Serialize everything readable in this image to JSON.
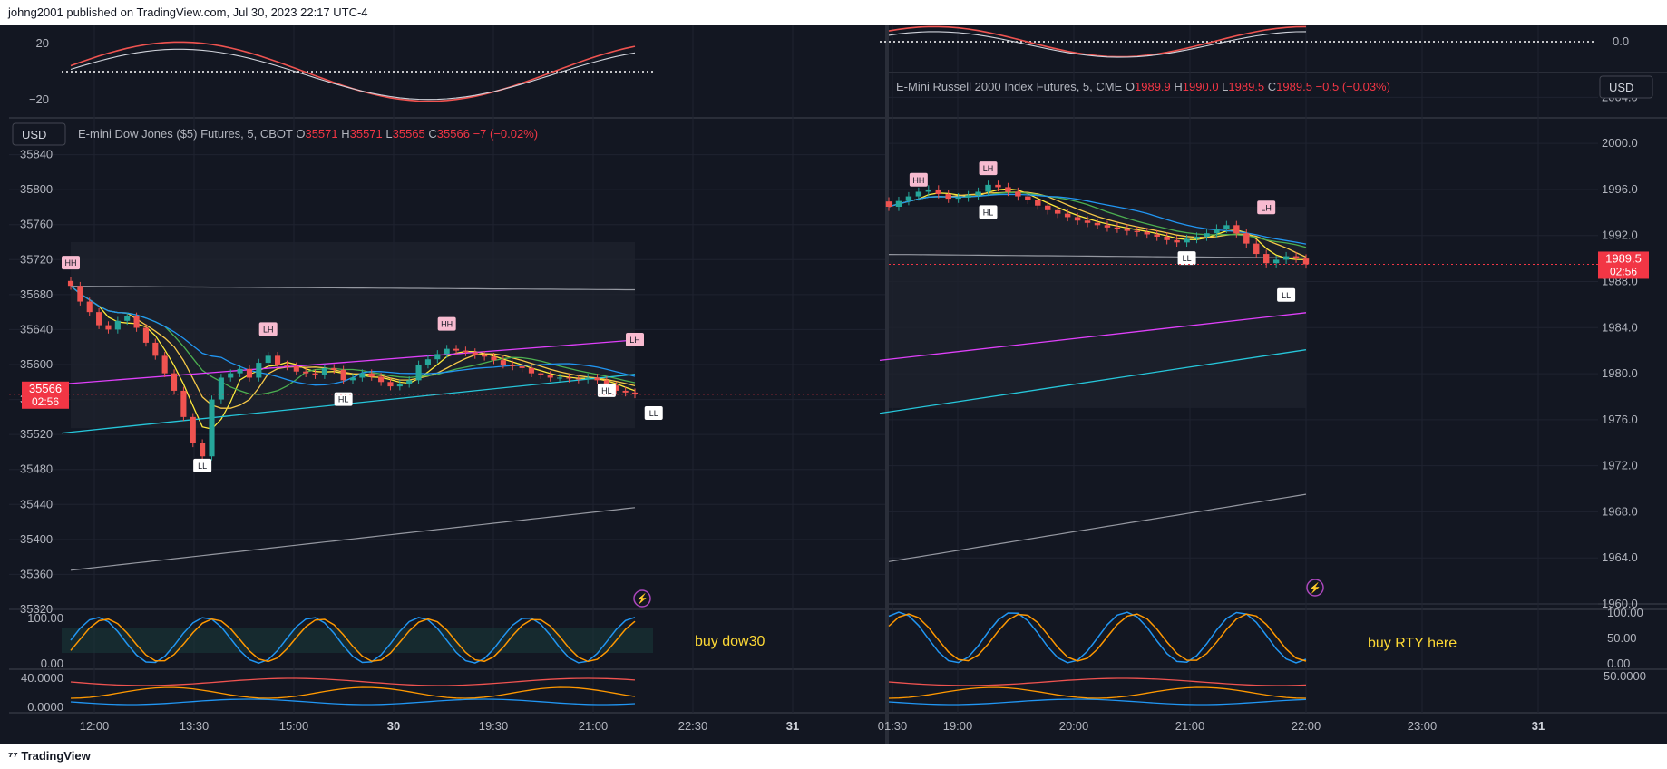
{
  "header": {
    "published": "johng2001 published on TradingView.com, Jul 30, 2023 22:17 UTC-4"
  },
  "footer": {
    "brand": "TradingView",
    "logo_icon": "tradingview-logo-icon"
  },
  "colors": {
    "bg": "#131722",
    "grid": "#1f2330",
    "up": "#26a69a",
    "down": "#ef5350",
    "text": "#b2b5be",
    "price_tag": "#f23645"
  },
  "chart_data": [
    {
      "type": "candlestick",
      "panel": "left",
      "currency": "USD",
      "symbol": "E-mini Dow Jones ($5) Futures, 5, CBOT",
      "ohlc": {
        "o": "35571",
        "h": "35571",
        "l": "35565",
        "c": "35566",
        "chg": "−7 (−0.02%)"
      },
      "last_price": "35566",
      "countdown": "02:56",
      "ylim": [
        35320,
        35880
      ],
      "yticks": [
        "35840",
        "35800",
        "35760",
        "35720",
        "35680",
        "35640",
        "35600",
        "35560",
        "35520",
        "35480",
        "35440",
        "35400",
        "35360",
        "35320"
      ],
      "xticks": [
        "12:00",
        "13:30",
        "15:00",
        "30",
        "19:30",
        "21:00",
        "22:30",
        "31",
        "01:30"
      ],
      "close_series": [
        35690,
        35672,
        35660,
        35645,
        35640,
        35650,
        35655,
        35642,
        35625,
        35610,
        35590,
        35570,
        35540,
        35510,
        35495,
        35560,
        35585,
        35590,
        35595,
        35585,
        35602,
        35610,
        35600,
        35598,
        35592,
        35590,
        35588,
        35596,
        35594,
        35582,
        35585,
        35590,
        35586,
        35580,
        35575,
        35578,
        35582,
        35600,
        35606,
        35612,
        35618,
        35616,
        35614,
        35611,
        35609,
        35605,
        35600,
        35598,
        35596,
        35590,
        35588,
        35585,
        35585,
        35584,
        35583,
        35585,
        35582,
        35576,
        35570,
        35568,
        35566
      ],
      "labels": [
        {
          "text": "HH",
          "t": 0,
          "price": 35716
        },
        {
          "text": "LL",
          "t": 14,
          "price": 35484
        },
        {
          "text": "LH",
          "t": 21,
          "price": 35640
        },
        {
          "text": "HL",
          "t": 29,
          "price": 35560
        },
        {
          "text": "HH",
          "t": 40,
          "price": 35646
        },
        {
          "text": "HL",
          "t": 57,
          "price": 35570
        },
        {
          "text": "LH",
          "t": 60,
          "price": 35628
        },
        {
          "text": "LL",
          "t": 62,
          "price": 35544
        }
      ],
      "oscillator_top": {
        "ticks": [
          "20",
          "−20"
        ],
        "ylim": [
          -40,
          40
        ]
      },
      "stochastic": {
        "ticks": [
          "100.00",
          "0.00"
        ],
        "ylim": [
          0,
          100
        ]
      },
      "lower_indicator": {
        "ticks": [
          "40.0000",
          "0.0000"
        ]
      },
      "annotation": "buy dow30"
    },
    {
      "type": "candlestick",
      "panel": "right",
      "currency": "USD",
      "symbol": "E-Mini Russell 2000 Index Futures, 5, CME",
      "ohlc": {
        "o": "1989.9",
        "h": "1990.0",
        "l": "1989.5",
        "c": "1989.5",
        "chg": "−0.5 (−0.03%)"
      },
      "last_price": "1989.5",
      "countdown": "02:56",
      "ylim": [
        1960,
        2006
      ],
      "yticks": [
        "2004.0",
        "2000.0",
        "1996.0",
        "1992.0",
        "1988.0",
        "1984.0",
        "1980.0",
        "1976.0",
        "1972.0",
        "1968.0",
        "1964.0",
        "1960.0"
      ],
      "xticks": [
        "19:00",
        "20:00",
        "21:00",
        "22:00",
        "23:00",
        "31"
      ],
      "close_series": [
        1994.5,
        1995.0,
        1995.4,
        1995.8,
        1996.0,
        1995.6,
        1995.2,
        1995.3,
        1995.5,
        1995.8,
        1996.4,
        1996.2,
        1995.8,
        1995.4,
        1995.1,
        1994.6,
        1994.2,
        1993.9,
        1993.6,
        1993.3,
        1993.1,
        1992.9,
        1992.7,
        1992.6,
        1992.4,
        1992.3,
        1992.1,
        1991.9,
        1991.6,
        1991.4,
        1991.7,
        1991.9,
        1992.2,
        1992.6,
        1992.9,
        1992.2,
        1991.3,
        1990.4,
        1989.6,
        1989.9,
        1990.2,
        1990.0,
        1989.5
      ],
      "labels": [
        {
          "text": "HH",
          "t": 3,
          "price": 1996.8
        },
        {
          "text": "LH",
          "t": 10,
          "price": 1997.8
        },
        {
          "text": "HL",
          "t": 10,
          "price": 1994.0
        },
        {
          "text": "LL",
          "t": 30,
          "price": 1990.0
        },
        {
          "text": "LH",
          "t": 38,
          "price": 1994.4
        },
        {
          "text": "LL",
          "t": 40,
          "price": 1986.8
        }
      ],
      "oscillator_top": {
        "ticks": [
          "0.0"
        ]
      },
      "stochastic": {
        "ticks": [
          "100.00",
          "50.00",
          "0.00"
        ],
        "ylim": [
          0,
          100
        ]
      },
      "lower_indicator": {
        "ticks": [
          "50.0000"
        ]
      },
      "annotation": "buy RTY here"
    }
  ]
}
